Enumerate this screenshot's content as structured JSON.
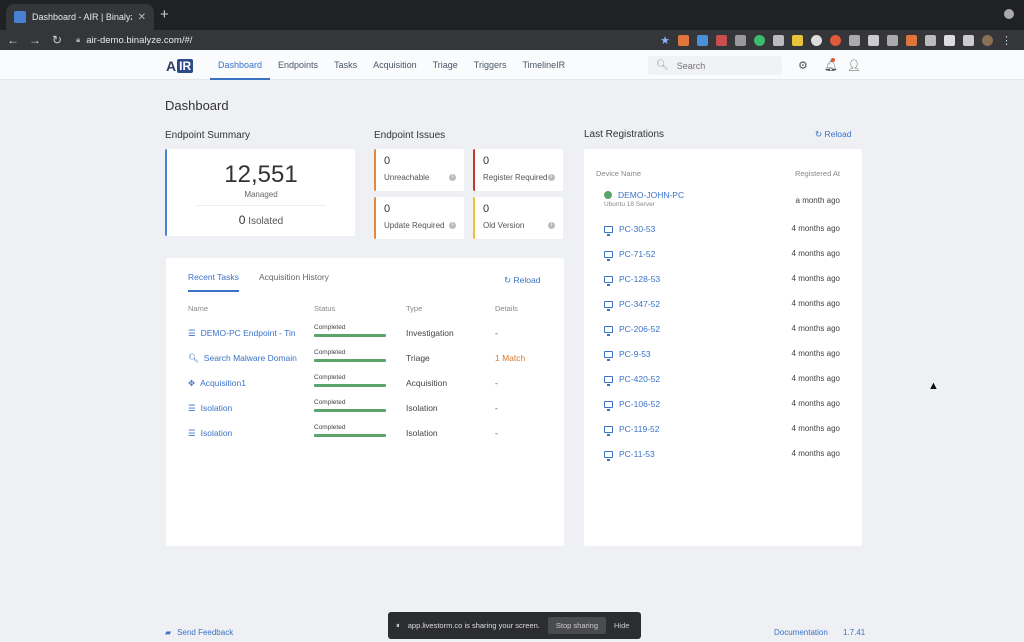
{
  "browser": {
    "tab_title": "Dashboard - AIR | Binalyze",
    "url": "air-demo.binalyze.com/#/"
  },
  "app": {
    "logo_a": "A",
    "logo_ir": "IR",
    "nav": [
      "Dashboard",
      "Endpoints",
      "Tasks",
      "Acquisition",
      "Triage",
      "Triggers",
      "TimelineIR"
    ],
    "search_placeholder": "Search"
  },
  "page_title": "Dashboard",
  "endpoint_summary": {
    "title": "Endpoint Summary",
    "managed_count": "12,551",
    "managed_label": "Managed",
    "isolated_count": "0",
    "isolated_label": "Isolated"
  },
  "endpoint_issues": {
    "title": "Endpoint Issues",
    "items": [
      {
        "count": "0",
        "label": "Unreachable",
        "color": "#e08a3a"
      },
      {
        "count": "0",
        "label": "Register Required",
        "color": "#c0392b"
      },
      {
        "count": "0",
        "label": "Update Required",
        "color": "#e08a3a"
      },
      {
        "count": "0",
        "label": "Old Version",
        "color": "#e8c23a"
      }
    ]
  },
  "tasks": {
    "tabs": [
      "Recent Tasks",
      "Acquisition History"
    ],
    "reload_label": "Reload",
    "columns": [
      "Name",
      "Status",
      "Type",
      "Details"
    ],
    "rows": [
      {
        "icon": "list-icon",
        "name": "DEMO-PC Endpoint - Tin",
        "status": "Completed",
        "progress": 1.0,
        "type": "Investigation",
        "details": "-"
      },
      {
        "icon": "search-icon",
        "name": "Search Malware Domain",
        "status": "Completed",
        "progress": 1.0,
        "type": "Triage",
        "details": "1 Match"
      },
      {
        "icon": "move-icon",
        "name": "Acquisition1",
        "status": "Completed",
        "progress": 1.0,
        "type": "Acquisition",
        "details": "-"
      },
      {
        "icon": "list-icon",
        "name": "Isolation",
        "status": "Completed",
        "progress": 1.0,
        "type": "Isolation",
        "details": "-"
      },
      {
        "icon": "list-icon",
        "name": "Isolation",
        "status": "Completed",
        "progress": 1.0,
        "type": "Isolation",
        "details": "-"
      }
    ]
  },
  "registrations": {
    "title": "Last Registrations",
    "reload_label": "Reload",
    "columns": [
      "Device Name",
      "Registered At"
    ],
    "rows": [
      {
        "name": "DEMO-JOHN-PC",
        "sub": "Ubuntu 18 Server",
        "when": "a month ago",
        "icon": "server-icon"
      },
      {
        "name": "PC-30-53",
        "when": "4 months ago",
        "icon": "monitor-icon"
      },
      {
        "name": "PC-71-52",
        "when": "4 months ago",
        "icon": "monitor-icon"
      },
      {
        "name": "PC-128-53",
        "when": "4 months ago",
        "icon": "monitor-icon"
      },
      {
        "name": "PC-347-52",
        "when": "4 months ago",
        "icon": "monitor-icon"
      },
      {
        "name": "PC-206-52",
        "when": "4 months ago",
        "icon": "monitor-icon"
      },
      {
        "name": "PC-9-53",
        "when": "4 months ago",
        "icon": "monitor-icon"
      },
      {
        "name": "PC-420-52",
        "when": "4 months ago",
        "icon": "monitor-icon"
      },
      {
        "name": "PC-106-52",
        "when": "4 months ago",
        "icon": "monitor-icon"
      },
      {
        "name": "PC-119-52",
        "when": "4 months ago",
        "icon": "monitor-icon"
      },
      {
        "name": "PC-11-53",
        "when": "4 months ago",
        "icon": "monitor-icon"
      }
    ]
  },
  "footer": {
    "feedback": "Send Feedback",
    "documentation": "Documentation",
    "version": "1.7.41"
  },
  "share_bar": {
    "message": "app.livestorm.co is sharing your screen.",
    "stop": "Stop sharing",
    "hide": "Hide"
  }
}
